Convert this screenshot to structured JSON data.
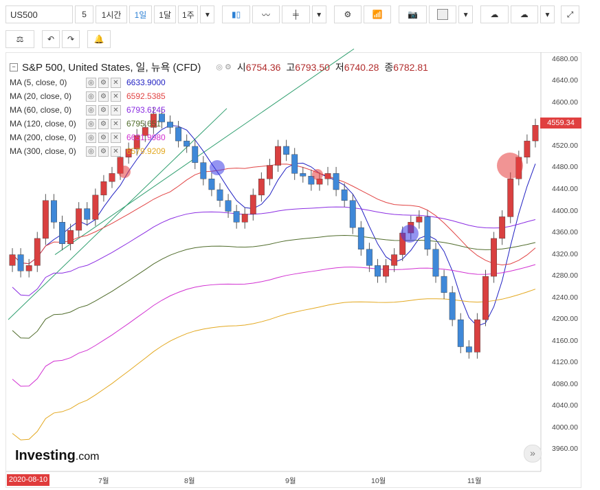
{
  "toolbar": {
    "symbol": "US500",
    "intervals": [
      "5",
      "1시간",
      "1일",
      "1달",
      "1주"
    ],
    "active_interval": "1일"
  },
  "chart_title": {
    "name": "S&P 500, United States, 일, 뉴욕 (CFD)",
    "open_label": "시",
    "open": "6754.36",
    "high_label": "고",
    "high": "6793.50",
    "low_label": "저",
    "low": "6740.28",
    "close_label": "종",
    "close": "6782.81"
  },
  "moving_averages": [
    {
      "label": "MA (5, close, 0)",
      "value": "6633.9000",
      "color": "#1f1fc2"
    },
    {
      "label": "MA (20, close, 0)",
      "value": "6592.5385",
      "color": "#e14343"
    },
    {
      "label": "MA (60, close, 0)",
      "value": "6793.6245",
      "color": "#8a2be2"
    },
    {
      "label": "MA (120, close, 0)",
      "value": "6795.651",
      "color": "#4f6b2a"
    },
    {
      "label": "MA (200, close, 0)",
      "value": "6651.9980",
      "color": "#d12fd1"
    },
    {
      "label": "MA (300, close, 0)",
      "value": "6579.9209",
      "color": "#e3a81f"
    }
  ],
  "y_axis_ticks": [
    "4680.00",
    "4640.00",
    "4600.00",
    "4560.00",
    "4520.00",
    "4480.00",
    "4440.00",
    "4400.00",
    "4360.00",
    "4320.00",
    "4280.00",
    "4240.00",
    "4200.00",
    "4160.00",
    "4120.00",
    "4080.00",
    "4040.00",
    "4000.00",
    "3960.00"
  ],
  "x_axis_ticks": [
    "7월",
    "8월",
    "9월",
    "10월",
    "11월"
  ],
  "current_date": "2020-08-10",
  "last_price": "4559.34",
  "logo": {
    "main": "Investing",
    "suffix": ".com"
  },
  "colors": {
    "up": "#d94040",
    "down": "#3f88d8",
    "accent": "#2a7fd4"
  },
  "chart_data": {
    "type": "candlestick",
    "ylim": [
      3940,
      4690
    ],
    "y_axis_position": "right",
    "grid": false,
    "candles_close": [
      4320,
      4290,
      4300,
      4350,
      4420,
      4380,
      4340,
      4365,
      4405,
      4385,
      4430,
      4455,
      4470,
      4500,
      4515,
      4540,
      4555,
      4580,
      4565,
      4555,
      4530,
      4520,
      4490,
      4460,
      4440,
      4420,
      4400,
      4380,
      4395,
      4430,
      4460,
      4485,
      4520,
      4505,
      4470,
      4465,
      4450,
      4460,
      4470,
      4440,
      4420,
      4370,
      4330,
      4300,
      4280,
      4300,
      4320,
      4360,
      4380,
      4390,
      4330,
      4280,
      4250,
      4200,
      4150,
      4140,
      4200,
      4280,
      4350,
      4390,
      4460,
      4500,
      4530,
      4559
    ],
    "annotations": [
      "trend lines",
      "highlight circles"
    ]
  }
}
